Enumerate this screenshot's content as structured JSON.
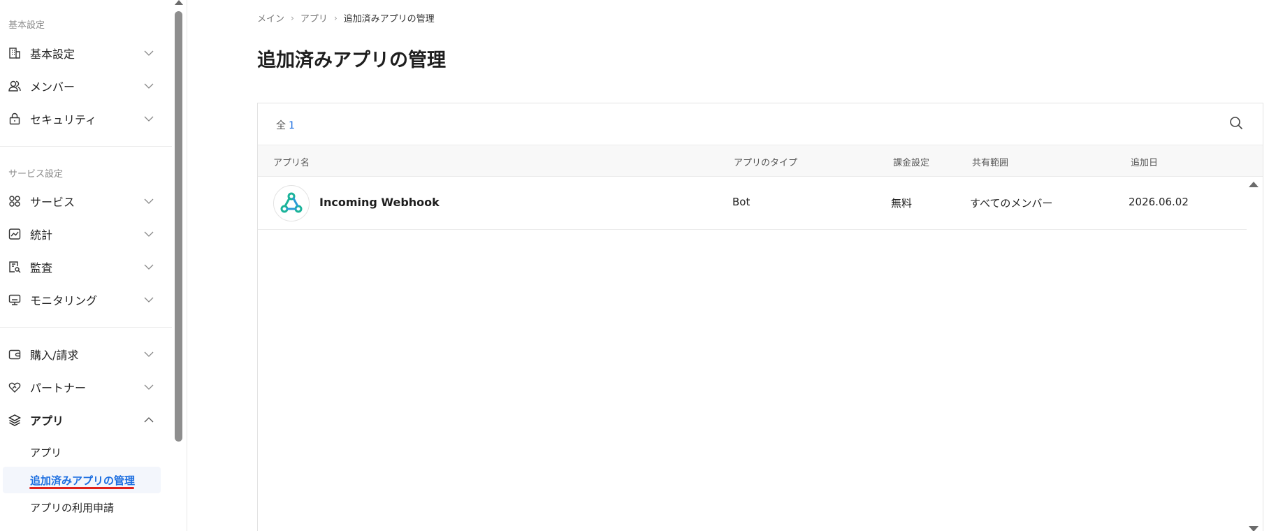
{
  "sidebar": {
    "section_basic": "基本設定",
    "section_service": "サービス設定",
    "items": {
      "basic": "基本設定",
      "members": "メンバー",
      "security": "セキュリティ",
      "service": "サービス",
      "stats": "統計",
      "audit": "監査",
      "monitoring": "モニタリング",
      "billing": "購入/請求",
      "partner": "パートナー",
      "apps": "アプリ"
    },
    "sub_items": {
      "apps": "アプリ",
      "added_apps": "追加済みアプリの管理",
      "app_requests": "アプリの利用申請"
    }
  },
  "breadcrumb": {
    "main": "メイン",
    "apps": "アプリ",
    "current": "追加済みアプリの管理"
  },
  "page": {
    "title": "追加済みアプリの管理"
  },
  "table": {
    "count_label": "全",
    "count_value": "1",
    "headers": {
      "name": "アプリ名",
      "type": "アプリのタイプ",
      "billing": "課金設定",
      "scope": "共有範囲",
      "added": "追加日"
    },
    "rows": [
      {
        "name": "Incoming Webhook",
        "type": "Bot",
        "billing": "無料",
        "scope": "すべてのメンバー",
        "added": "2026.06.02"
      }
    ]
  },
  "icons": {
    "basic": "building-icon",
    "members": "users-icon",
    "security": "lock-icon",
    "service": "grid-icon",
    "stats": "chart-icon",
    "audit": "audit-icon",
    "monitoring": "monitor-icon",
    "billing": "wallet-icon",
    "partner": "handshake-icon",
    "apps": "layers-icon",
    "search": "search-icon",
    "chevron": "chevron-down-icon",
    "webhook": "webhook-icon"
  },
  "colors": {
    "accent": "#1c6ee0",
    "active_bg": "#f3f6fc",
    "underline": "#e0211b",
    "webhook_logo": "#1bb39a"
  }
}
